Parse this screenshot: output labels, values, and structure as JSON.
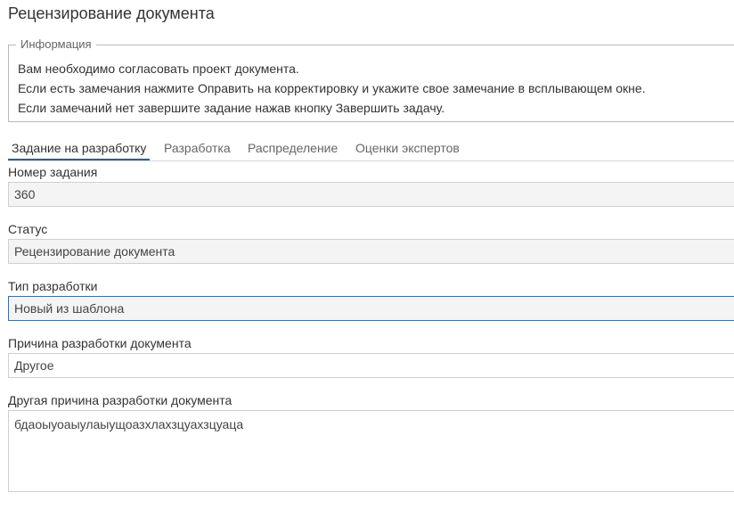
{
  "page": {
    "title": "Рецензирование документа"
  },
  "info": {
    "legend": "Информация",
    "lines": [
      "Вам необходимо согласовать проект документа.",
      "Если есть замечания нажмите Оправить на корректировку и укажите свое замечание в всплывающем окне.",
      "Если замечаний нет завершите задание нажав кнопку Завершить задачу."
    ]
  },
  "tabs": [
    {
      "label": "Задание на разработку",
      "active": true
    },
    {
      "label": "Разработка",
      "active": false
    },
    {
      "label": "Распределение",
      "active": false
    },
    {
      "label": "Оценки экспертов",
      "active": false
    }
  ],
  "form": {
    "task_number": {
      "label": "Номер задания",
      "value": "360"
    },
    "status": {
      "label": "Статус",
      "value": "Рецензирование документа"
    },
    "dev_type": {
      "label": "Тип разработки",
      "value": "Новый из шаблона"
    },
    "reason": {
      "label": "Причина разработки документа",
      "value": "Другое"
    },
    "other_reason": {
      "label": "Другая причина разработки документа",
      "value": "бдаоыуоаыулаыущоазхлахзцуахзцуаца"
    }
  },
  "colors": {
    "accent": "#2f5f8b",
    "border": "#cfcfcf",
    "readonly_bg": "#f4f4f4"
  }
}
